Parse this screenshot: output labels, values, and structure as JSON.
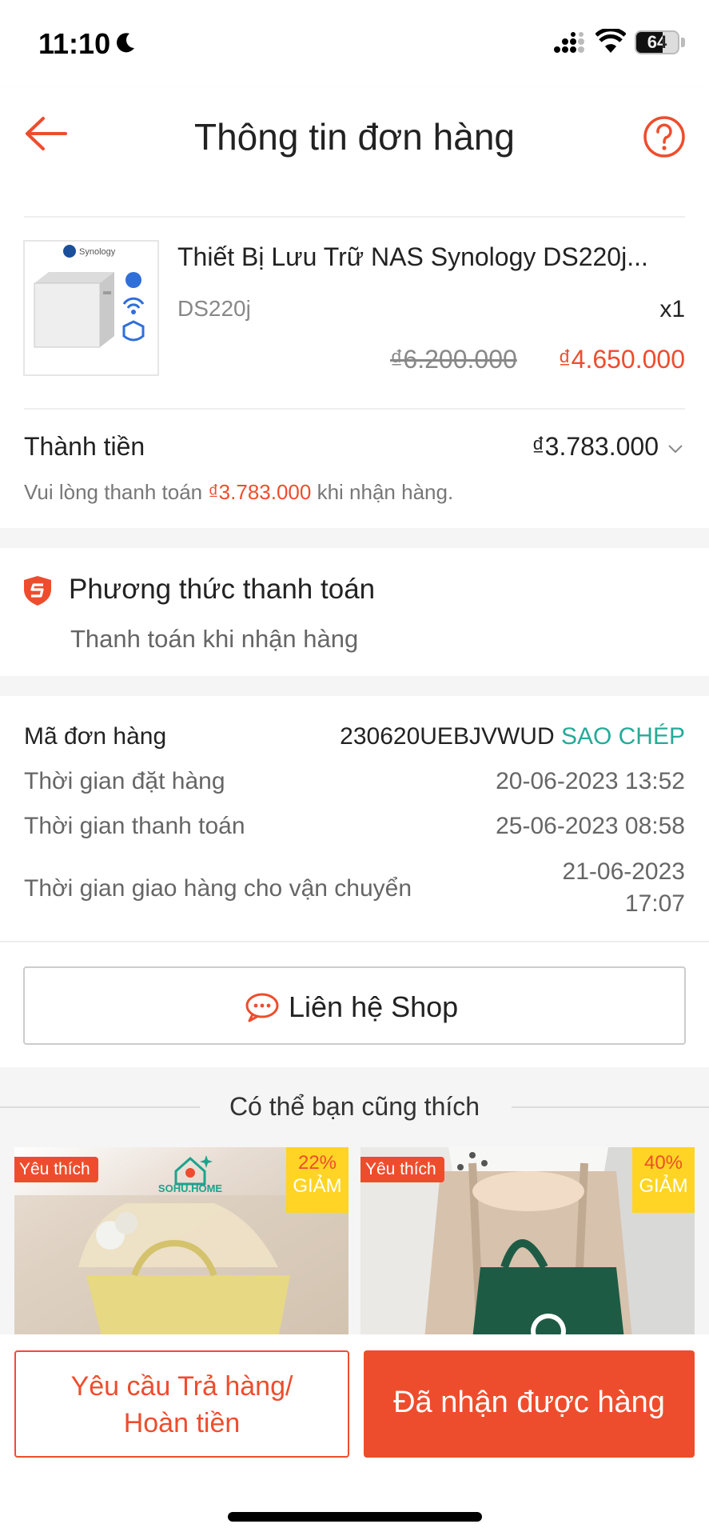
{
  "status_bar": {
    "time": "11:10",
    "battery": "64"
  },
  "header": {
    "title": "Thông tin đơn hàng"
  },
  "product": {
    "brand_logo": "Synology",
    "name": "Thiết Bị Lưu Trữ NAS Synology DS220j...",
    "variant": "DS220j",
    "quantity": "x1",
    "price_original": "₫6.200.000",
    "price_sale": "₫4.650.000"
  },
  "total": {
    "label": "Thành tiền",
    "value": "₫3.783.000",
    "note_prefix": "Vui lòng thanh toán ",
    "note_amount": "₫3.783.000",
    "note_suffix": " khi nhận hàng."
  },
  "payment": {
    "title": "Phương thức thanh toán",
    "method": "Thanh toán khi nhận hàng"
  },
  "order": {
    "id_label": "Mã đơn hàng",
    "id_value": "230620UEBJVWUD",
    "copy_label": "SAO CHÉP",
    "order_time_label": "Thời gian đặt hàng",
    "order_time_value": "20-06-2023 13:52",
    "payment_time_label": "Thời gian thanh toán",
    "payment_time_value": "25-06-2023 08:58",
    "ship_time_label": "Thời gian giao hàng cho vận chuyển",
    "ship_time_date": "21-06-2023",
    "ship_time_hour": "17:07"
  },
  "contact": {
    "label": "Liên hệ Shop"
  },
  "recommendations": {
    "title": "Có thể bạn cũng thích",
    "items": [
      {
        "badge": "Yêu thích",
        "discount_pct": "22%",
        "discount_text": "GIẢM",
        "shop_logo": "SOHU.HOME"
      },
      {
        "badge": "Yêu thích",
        "discount_pct": "40%",
        "discount_text": "GIẢM"
      }
    ]
  },
  "actions": {
    "return_line1": "Yêu cầu Trả hàng/",
    "return_line2": "Hoàn tiền",
    "received": "Đã nhận được hàng"
  },
  "colors": {
    "accent": "#ee4d2d",
    "copy": "#26aa99",
    "discount_bg": "#ffd424"
  },
  "icons": [
    "moon-icon",
    "signal-icon",
    "wifi-icon",
    "back-arrow-icon",
    "help-icon",
    "chevron-down-icon",
    "shield-icon",
    "chat-icon"
  ]
}
